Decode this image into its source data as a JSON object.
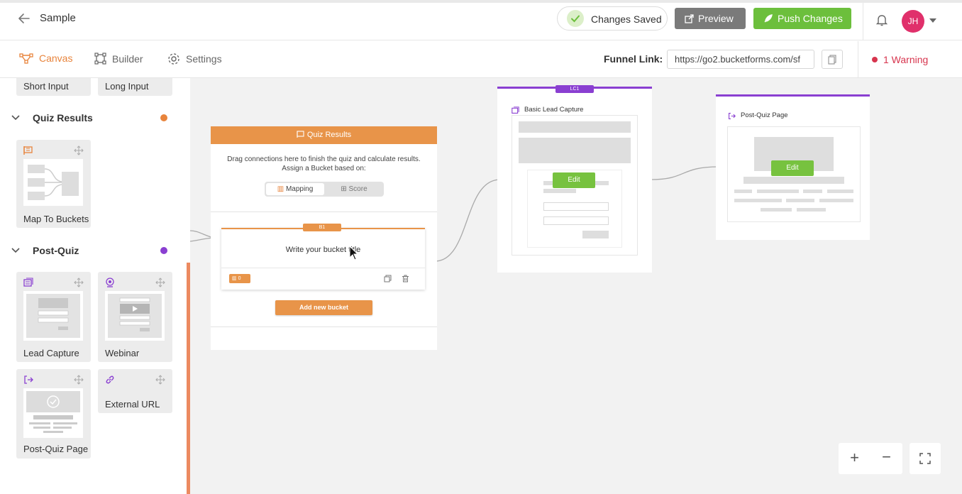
{
  "header": {
    "title": "Sample",
    "status": "Changes Saved",
    "preview_label": "Preview",
    "push_label": "Push Changes",
    "avatar_initials": "JH"
  },
  "tabs": [
    {
      "label": "Canvas",
      "active": true
    },
    {
      "label": "Builder",
      "active": false
    },
    {
      "label": "Settings",
      "active": false
    }
  ],
  "funnel": {
    "label": "Funnel Link:",
    "url": "https://go2.bucketforms.com/sf"
  },
  "warning": "1 Warning",
  "sidebar": {
    "top_items": [
      "Short Input",
      "Long Input"
    ],
    "sections": [
      {
        "title": "Quiz Results",
        "dot_color": "#e8843c",
        "items": [
          "Map To Buckets"
        ]
      },
      {
        "title": "Post-Quiz",
        "dot_color": "#8a3fd1",
        "items": [
          "Lead Capture",
          "Webinar",
          "Post-Quiz Page",
          "External URL"
        ]
      }
    ]
  },
  "canvas": {
    "quiz_results": {
      "header": "Quiz Results",
      "instructions_line1": "Drag connections here to finish the quiz and calculate results.",
      "instructions_line2": "Assign a Bucket based on:",
      "toggle_mapping": "Mapping",
      "toggle_score": "Score",
      "bucket_tag": "B1",
      "bucket_title": "Write your bucket title",
      "bucket_badge": "0",
      "add_bucket": "Add new bucket"
    },
    "lead_capture": {
      "tag": "LC1",
      "title": "Basic Lead Capture",
      "edit": "Edit"
    },
    "post_quiz": {
      "title": "Post-Quiz Page",
      "edit": "Edit"
    }
  },
  "colors": {
    "accent_orange": "#e8843c",
    "accent_purple": "#8a3fd1",
    "green": "#6cbf3c",
    "warning_red": "#d7354e"
  }
}
